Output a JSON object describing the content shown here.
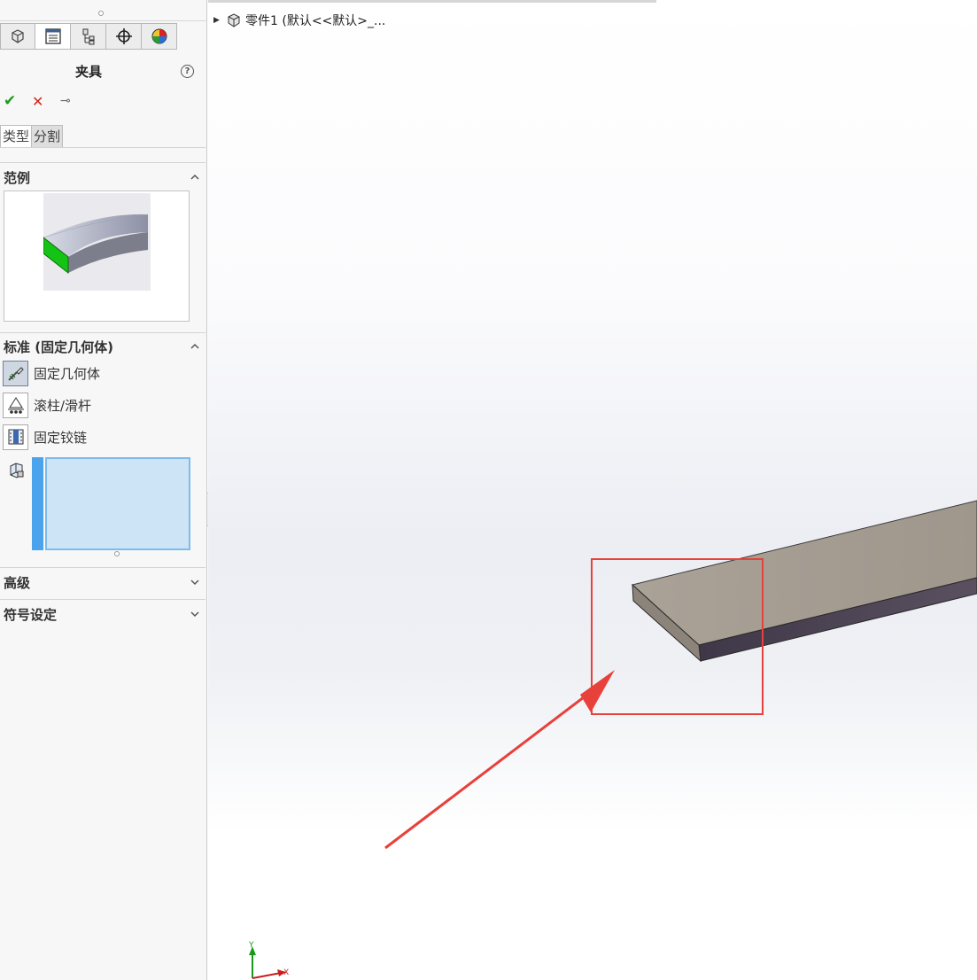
{
  "panel": {
    "tabs": [
      {
        "icon": "feature-manager-icon"
      },
      {
        "icon": "property-manager-icon"
      },
      {
        "icon": "configuration-manager-icon"
      },
      {
        "icon": "dimxpert-icon"
      },
      {
        "icon": "display-manager-icon"
      }
    ],
    "title": "夹具",
    "help_symbol": "?",
    "ok_symbol": "✔",
    "cancel_symbol": "✕",
    "pin_symbol": "⊸",
    "prop_tabs": [
      "类型",
      "分割"
    ],
    "sections": {
      "example": "范例",
      "standard": "标准 (固定几何体)",
      "advanced": "高级",
      "symbol": "符号设定"
    },
    "options": [
      {
        "label": "固定几何体",
        "icon": "fixed-geometry-icon",
        "selected": true
      },
      {
        "label": "滚柱/滑杆",
        "icon": "roller-slider-icon",
        "selected": false
      },
      {
        "label": "固定铰链",
        "icon": "fixed-hinge-icon",
        "selected": false
      }
    ]
  },
  "viewport": {
    "tree_item": "零件1  (默认<<默认>_...",
    "triad": {
      "y": "Y",
      "x": "X"
    },
    "colors": {
      "annotation": "#e8403a",
      "part_top": "#a79f95",
      "part_side": "#4b4350",
      "part_end": "#8c847a",
      "selection": "#cde4f7",
      "accent": "#4aa3ec"
    }
  }
}
